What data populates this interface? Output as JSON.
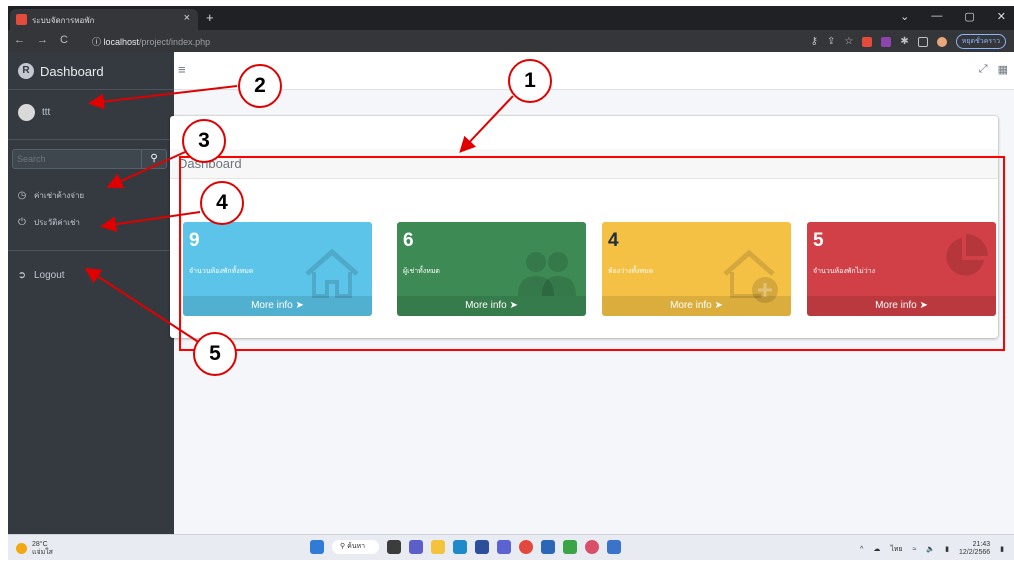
{
  "browser": {
    "tab_title": "ระบบจัดการหอพัก",
    "tab_close": "×",
    "new_tab": "+",
    "win_controls": [
      "⌄",
      "—",
      "▢",
      "✕"
    ],
    "nav": [
      "←",
      "→",
      "C"
    ],
    "url_host": "localhost",
    "url_path": "/project/index.php",
    "profile_label": "หยุดชั่วคราว"
  },
  "sidebar": {
    "brand": "Dashboard",
    "brand_logo": "R",
    "user_name": "ttt",
    "search_placeholder": "Search",
    "search_icon": "🔍",
    "items": [
      {
        "icon": "🕓",
        "label": "ค่าเช่าค้างจ่าย"
      },
      {
        "icon": "↻",
        "label": "ประวัติค่าเช่า"
      },
      {
        "icon": "➜",
        "label": "Logout"
      }
    ]
  },
  "topbar": {
    "hamburger": "≡",
    "expand_icon": "⤢",
    "grid_icon": "▦"
  },
  "card": {
    "title": "Dashboard"
  },
  "boxes": [
    {
      "value": "9",
      "label": "จำนวนห้องพักทั้งหมด",
      "footer": "More info",
      "color": "#5bc4e8",
      "icon": "house-icon"
    },
    {
      "value": "6",
      "label": "ผู้เช่าทั้งหมด",
      "footer": "More info",
      "color": "#3d8a55",
      "icon": "users-icon"
    },
    {
      "value": "4",
      "label": "ห้องว่างทั้งหมด",
      "footer": "More info",
      "color": "#f4c145",
      "icon": "house-plus-icon"
    },
    {
      "value": "5",
      "label": "จำนวนห้องพักไม่ว่าง",
      "footer": "More info",
      "color": "#d04046",
      "icon": "pie-chart-icon"
    }
  ],
  "annotations": [
    "1",
    "2",
    "3",
    "4",
    "5"
  ],
  "annotation_color": "#e00000",
  "taskbar": {
    "temp": "28°C",
    "weather_desc": "แจ่มใส",
    "search_label": "ค้นหา",
    "lang": "ไทย",
    "time": "21:43",
    "date": "12/2/2566"
  }
}
